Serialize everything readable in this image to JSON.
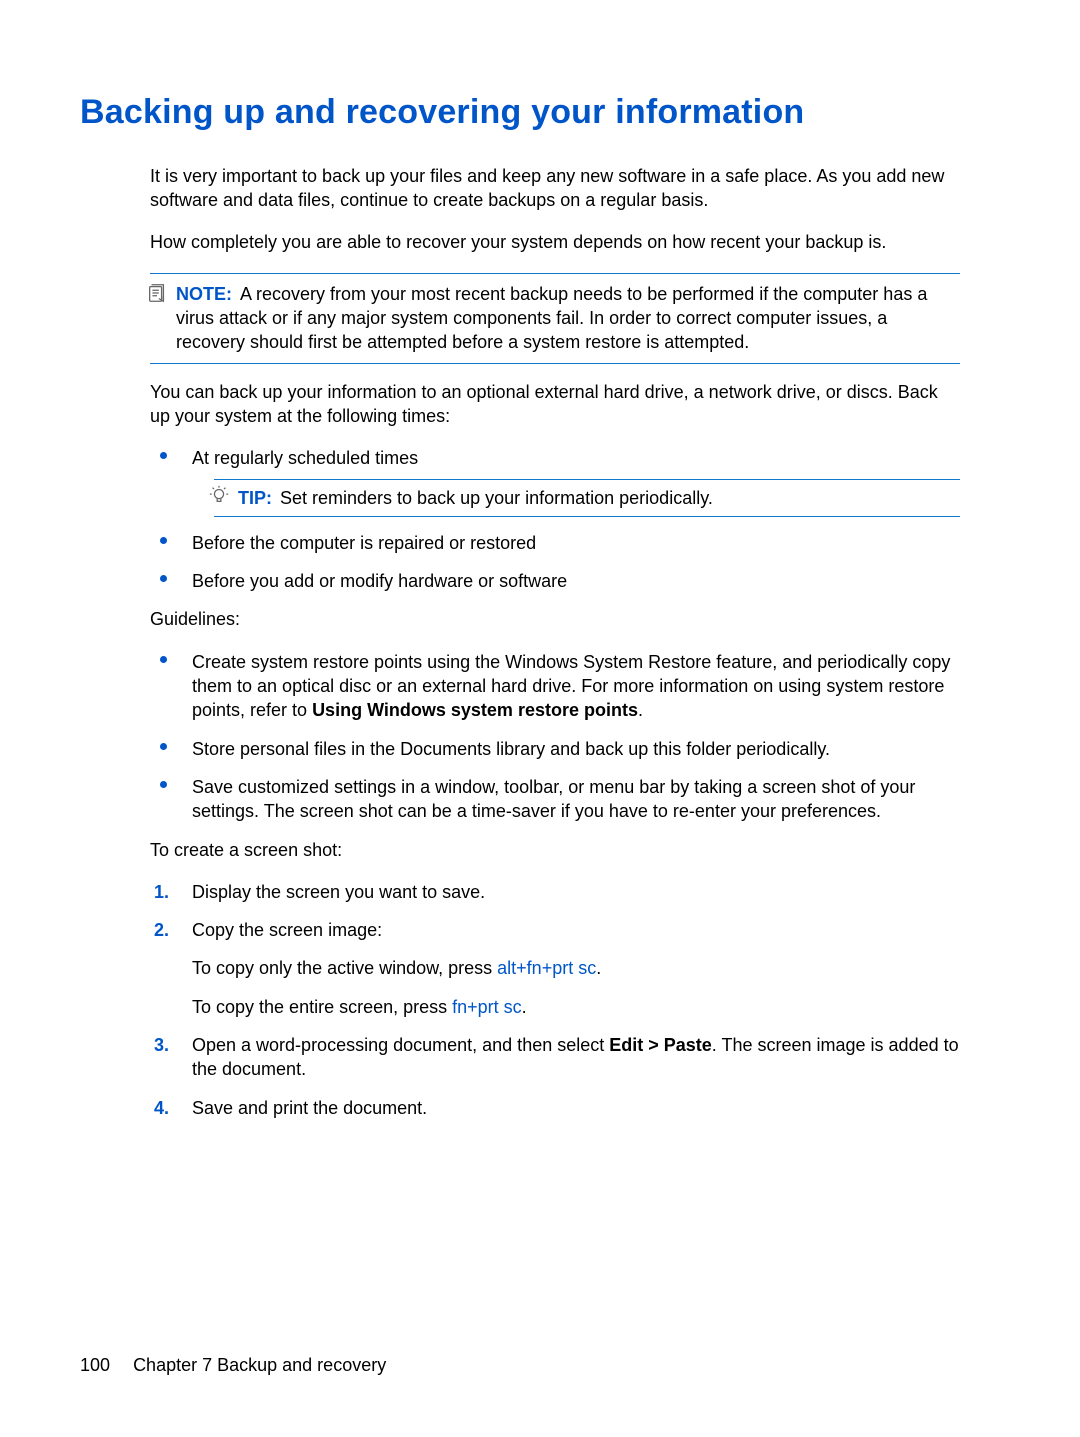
{
  "title": "Backing up and recovering your information",
  "paragraphs": {
    "intro1": "It is very important to back up your files and keep any new software in a safe place. As you add new software and data files, continue to create backups on a regular basis.",
    "intro2": "How completely you are able to recover your system depends on how recent your backup is.",
    "note_label": "NOTE:",
    "note_body": "A recovery from your most recent backup needs to be performed if the computer has a virus attack or if any major system components fail. In order to correct computer issues, a recovery should first be attempted before a system restore is attempted.",
    "backup_targets": "You can back up your information to an optional external hard drive, a network drive, or discs. Back up your system at the following times:",
    "tip_label": "TIP:",
    "tip_body": "Set reminders to back up your information periodically.",
    "guidelines_label": "Guidelines:",
    "screenshot_label": "To create a screen shot:"
  },
  "times_list": {
    "item1": "At regularly scheduled times",
    "item2": "Before the computer is repaired or restored",
    "item3": "Before you add or modify hardware or software"
  },
  "guidelines_list": {
    "item1_pre": "Create system restore points using the Windows System Restore feature, and periodically copy them to an optical disc or an external hard drive. For more information on using system restore points, refer to ",
    "item1_bold": "Using Windows system restore points",
    "item1_post": ".",
    "item2": "Store personal files in the Documents library and back up this folder periodically.",
    "item3": "Save customized settings in a window, toolbar, or menu bar by taking a screen shot of your settings. The screen shot can be a time-saver if you have to re-enter your preferences."
  },
  "steps": {
    "s1": "Display the screen you want to save.",
    "s2": "Copy the screen image:",
    "s2a_pre": "To copy only the active window, press ",
    "s2a_key": "alt+fn+prt sc",
    "s2a_post": ".",
    "s2b_pre": "To copy the entire screen, press ",
    "s2b_key": "fn+prt sc",
    "s2b_post": ".",
    "s3_pre": "Open a word-processing document, and then select ",
    "s3_bold": "Edit > Paste",
    "s3_post": ". The screen image is added to the document.",
    "s4": "Save and print the document."
  },
  "footer": {
    "page_number": "100",
    "chapter": "Chapter 7   Backup and recovery"
  }
}
